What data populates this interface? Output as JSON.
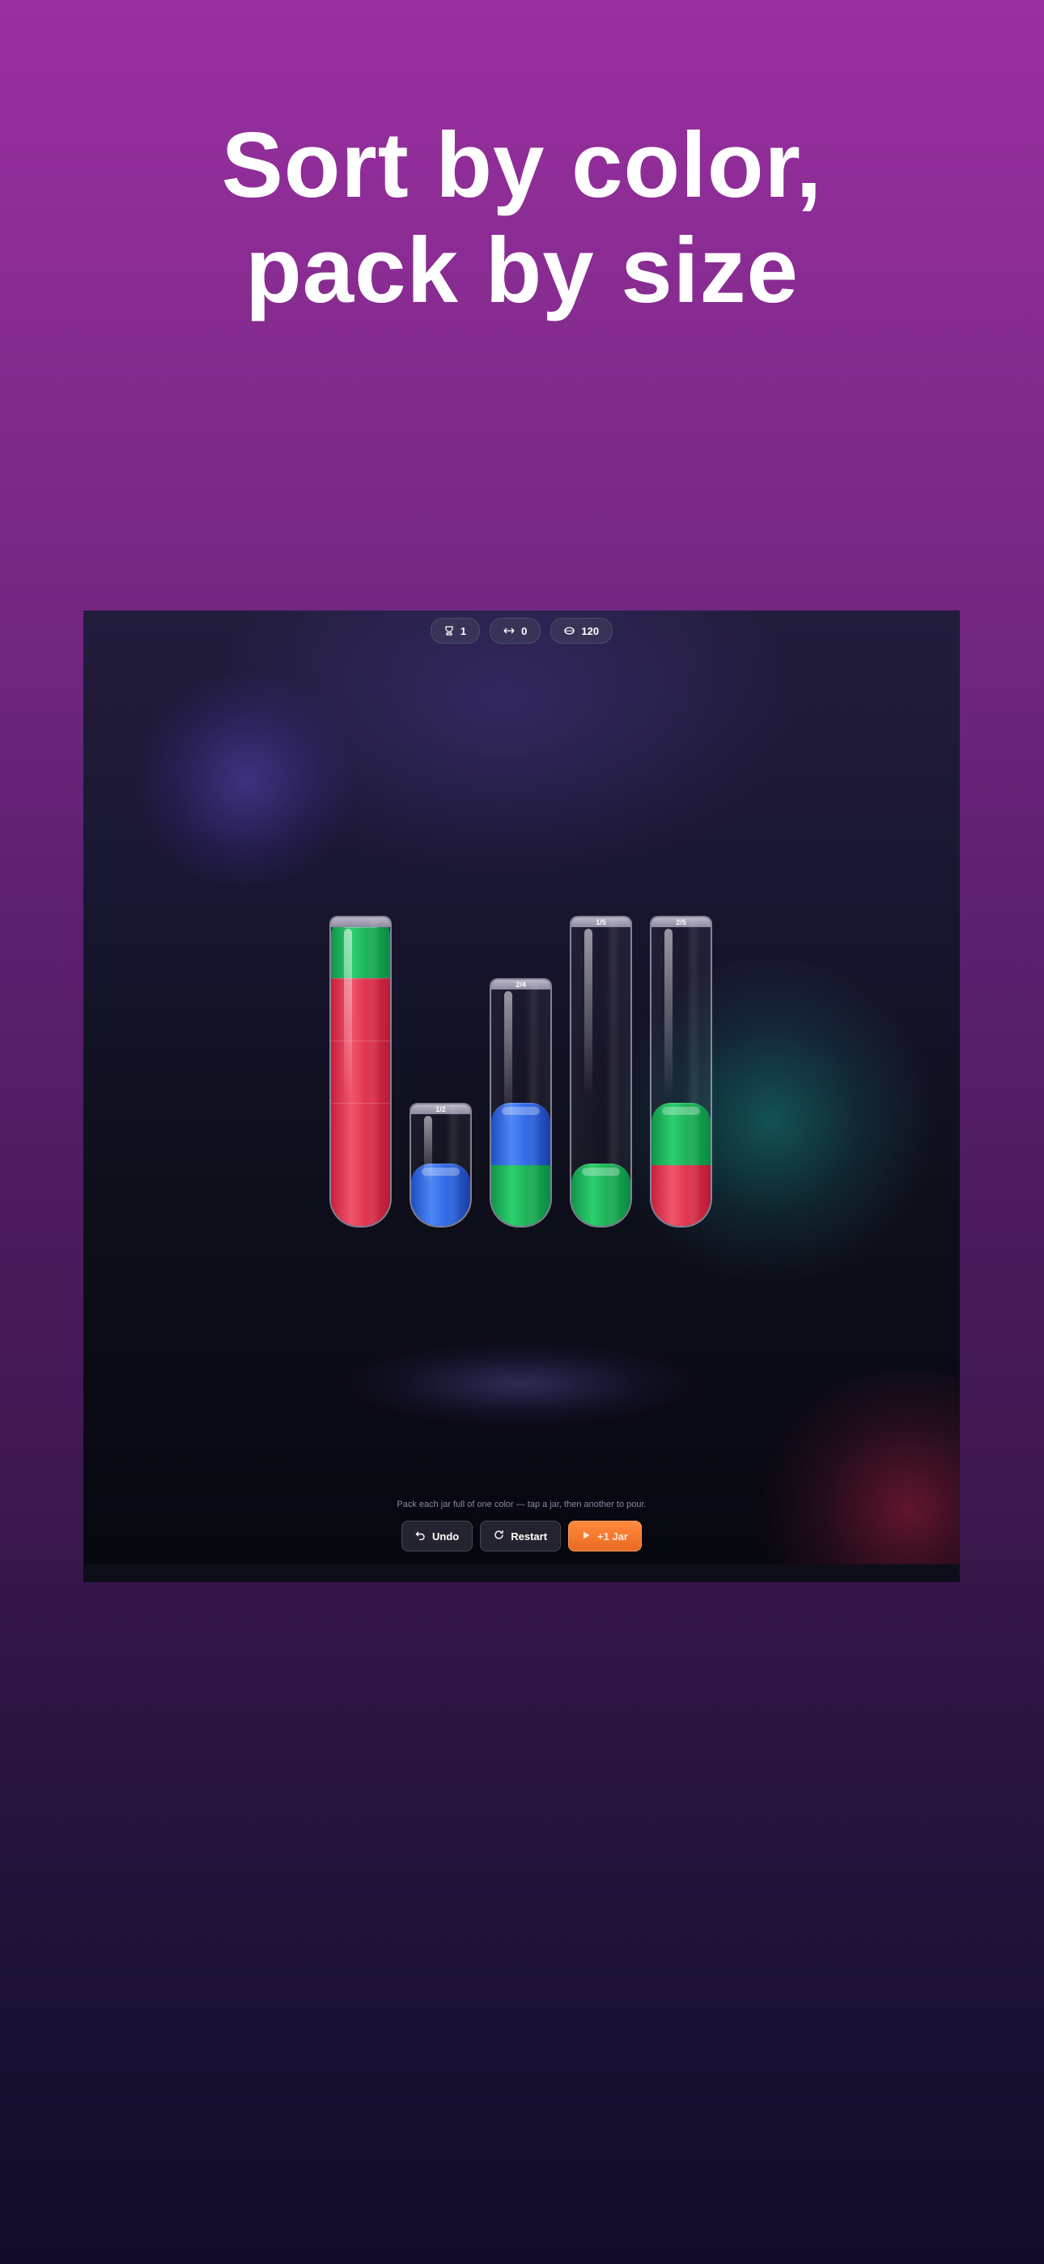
{
  "headline": {
    "line1": "Sort by color,",
    "line2": "pack by size"
  },
  "hud": {
    "level": {
      "icon": "trophy-icon",
      "value": "1"
    },
    "moves": {
      "icon": "swap-arrows-icon",
      "value": "0"
    },
    "coins": {
      "icon": "coin-icon",
      "value": "120"
    }
  },
  "colors": {
    "red": "#e1344e",
    "green": "#1db359",
    "blue": "#3169e6",
    "accent": "#f47a30"
  },
  "jars": [
    {
      "capacity": 5,
      "label": "",
      "contents": [
        "red",
        "red",
        "red",
        "red",
        "green"
      ]
    },
    {
      "capacity": 2,
      "label": "1/2",
      "contents": [
        "blue"
      ]
    },
    {
      "capacity": 4,
      "label": "2/4",
      "contents": [
        "green",
        "blue"
      ]
    },
    {
      "capacity": 5,
      "label": "1/5",
      "contents": [
        "green"
      ]
    },
    {
      "capacity": 5,
      "label": "2/5",
      "contents": [
        "red",
        "green"
      ]
    }
  ],
  "hint": "Pack each jar full of one color — tap a jar, then another to pour.",
  "controls": {
    "undo": {
      "label": "Undo",
      "icon": "undo-icon"
    },
    "restart": {
      "label": "Restart",
      "icon": "restart-icon"
    },
    "add_jar": {
      "label": "+1 Jar",
      "icon": "play-icon"
    }
  }
}
